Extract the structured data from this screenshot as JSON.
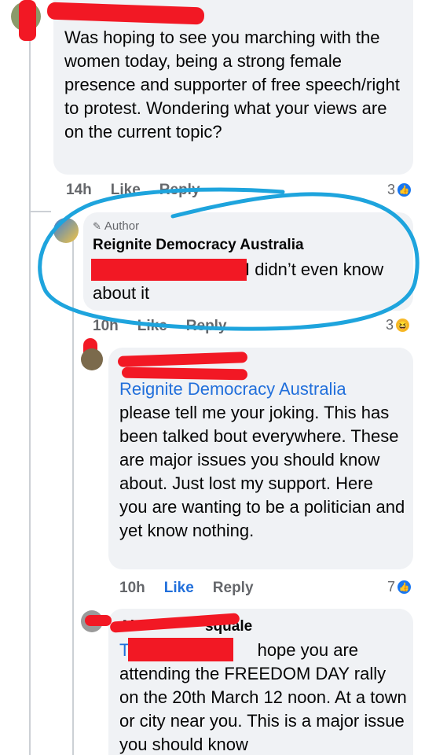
{
  "comments": [
    {
      "text": "Was hoping to see you marching with the women today, being a strong female presence and supporter of free speech/right to protest. Wondering what your views are on the current topic?",
      "time": "14h",
      "like_label": "Like",
      "reply_label": "Reply",
      "reaction_count": "3"
    },
    {
      "badge": "Author",
      "author": "Reignite Democracy Australia",
      "text_after_redaction": "I didn’t even know",
      "text_line2": "about it",
      "time": "10h",
      "like_label": "Like",
      "reply_label": "Reply",
      "reaction_count": "3"
    },
    {
      "mention": "Reignite Democracy Australia",
      "text": "please tell me your joking.  This has been talked bout everywhere.  These are major issues you should know about. Just lost my support.  Here you are wanting to be a politician and yet know nothing.",
      "time": "10h",
      "like_label": "Like",
      "reply_label": "Reply",
      "reaction_count": "7"
    },
    {
      "author_partial": "Al",
      "author_suffix": "squale",
      "mention_partial": "T",
      "text_after_redaction": "hope you are",
      "text": "attending the FREEDOM DAY rally on the 20th March 12 noon. At a town or city near you. This is a major issue you should know"
    }
  ],
  "colors": {
    "bubble": "#f0f2f5",
    "mention": "#216fdb",
    "meta": "#65676b",
    "redaction": "#f21824",
    "annotation": "#1ea4dd"
  },
  "icons": [
    "like-icon",
    "haha-icon",
    "pencil-icon"
  ]
}
